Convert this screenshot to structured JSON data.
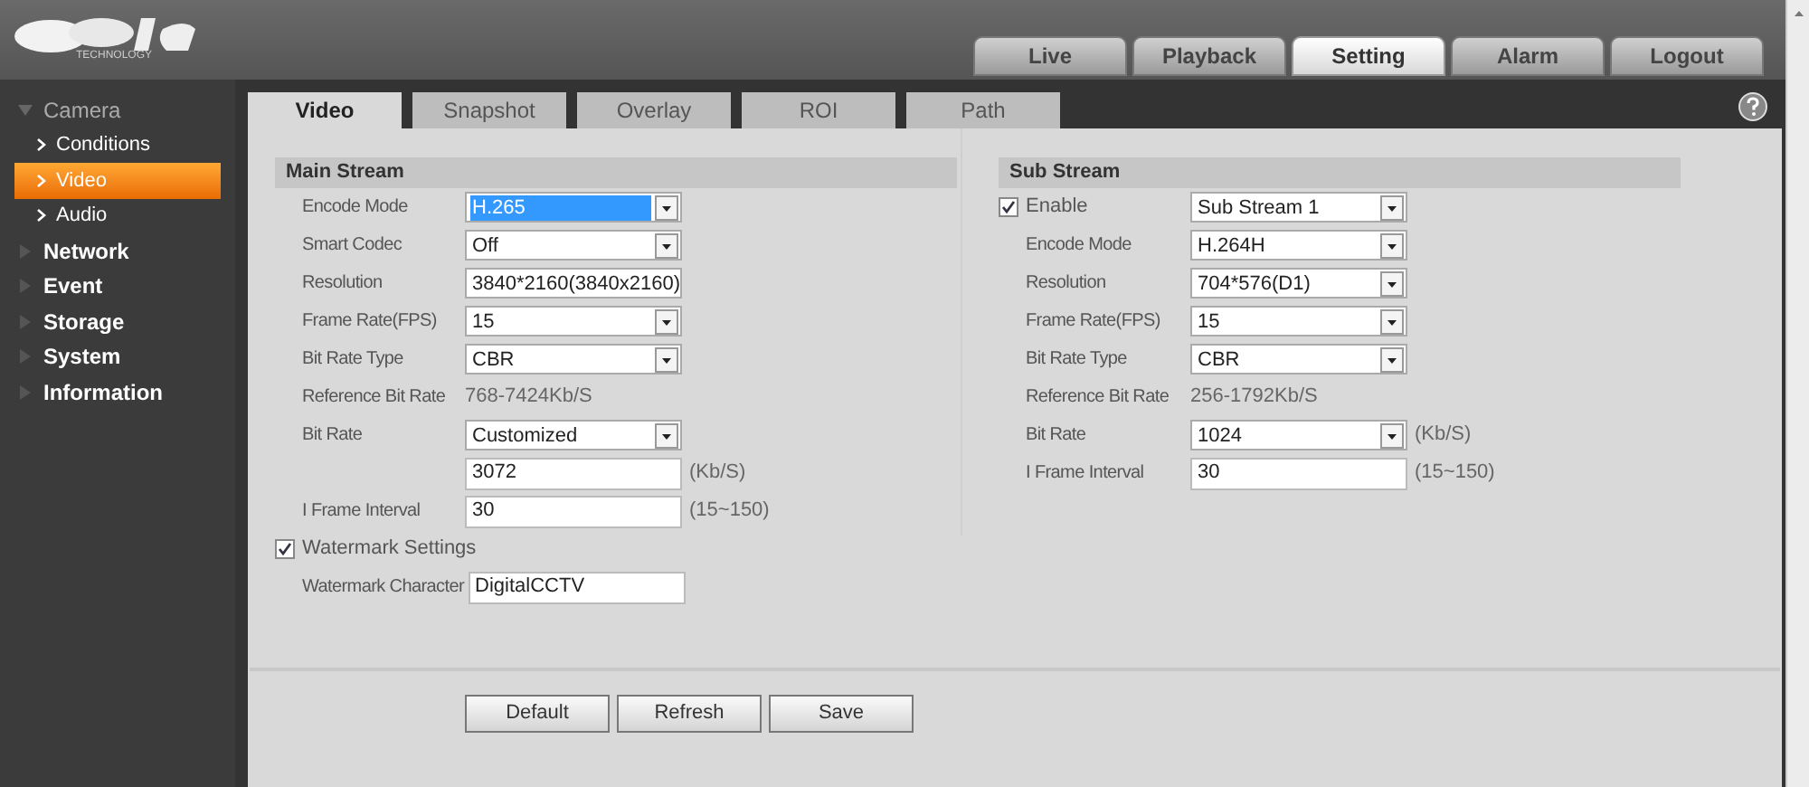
{
  "logo": {
    "tagline": "TECHNOLOGY"
  },
  "top_nav": [
    {
      "label": "Live",
      "selected": false
    },
    {
      "label": "Playback",
      "selected": false
    },
    {
      "label": "Setting",
      "selected": true
    },
    {
      "label": "Alarm",
      "selected": false
    },
    {
      "label": "Logout",
      "selected": false
    }
  ],
  "sidebar": [
    {
      "label": "Camera",
      "expanded": true,
      "children": [
        {
          "label": "Conditions",
          "selected": false
        },
        {
          "label": "Video",
          "selected": true
        },
        {
          "label": "Audio",
          "selected": false
        }
      ]
    },
    {
      "label": "Network",
      "expanded": false
    },
    {
      "label": "Event",
      "expanded": false
    },
    {
      "label": "Storage",
      "expanded": false
    },
    {
      "label": "System",
      "expanded": false
    },
    {
      "label": "Information",
      "expanded": false
    }
  ],
  "tabs": [
    {
      "label": "Video",
      "selected": true
    },
    {
      "label": "Snapshot",
      "selected": false
    },
    {
      "label": "Overlay",
      "selected": false
    },
    {
      "label": "ROI",
      "selected": false
    },
    {
      "label": "Path",
      "selected": false
    }
  ],
  "main_stream": {
    "title": "Main Stream",
    "rows": [
      {
        "kind": "select",
        "label": "Encode Mode",
        "value": "H.265",
        "highlighted": true
      },
      {
        "kind": "select",
        "label": "Smart Codec",
        "value": "Off",
        "highlighted": false
      },
      {
        "kind": "select",
        "label": "Resolution",
        "value": "3840*2160(3840x2160)",
        "highlighted": false
      },
      {
        "kind": "select",
        "label": "Frame Rate(FPS)",
        "value": "15",
        "highlighted": false
      },
      {
        "kind": "select",
        "label": "Bit Rate Type",
        "value": "CBR",
        "highlighted": false
      },
      {
        "kind": "text",
        "label": "Reference Bit Rate",
        "value": "768-7424Kb/S"
      },
      {
        "kind": "select",
        "label": "Bit Rate",
        "value": "Customized",
        "highlighted": false
      },
      {
        "kind": "input",
        "value": "3072",
        "unit": "(Kb/S)"
      },
      {
        "kind": "input",
        "label": "I Frame Interval",
        "value": "30",
        "unit": "(15~150)"
      },
      {
        "kind": "checkbox",
        "label": "Watermark Settings",
        "checked": true
      },
      {
        "kind": "input",
        "label": "Watermark Character",
        "value": "DigitalCCTV"
      }
    ]
  },
  "sub_stream": {
    "title": "Sub Stream",
    "rows": [
      {
        "kind": "checkbox_select",
        "label": "Enable",
        "checked": true,
        "value": "Sub Stream 1"
      },
      {
        "kind": "select",
        "label": "Encode Mode",
        "value": "H.264H",
        "highlighted": false
      },
      {
        "kind": "select",
        "label": "Resolution",
        "value": "704*576(D1)",
        "highlighted": false
      },
      {
        "kind": "select",
        "label": "Frame Rate(FPS)",
        "value": "15",
        "highlighted": false
      },
      {
        "kind": "select",
        "label": "Bit Rate Type",
        "value": "CBR",
        "highlighted": false
      },
      {
        "kind": "text",
        "label": "Reference Bit Rate",
        "value": "256-1792Kb/S"
      },
      {
        "kind": "select",
        "label": "Bit Rate",
        "value": "1024",
        "unit": "(Kb/S)",
        "highlighted": false
      },
      {
        "kind": "input",
        "label": "I Frame Interval",
        "value": "30",
        "unit": "(15~150)"
      }
    ]
  },
  "buttons": [
    "Default",
    "Refresh",
    "Save"
  ]
}
